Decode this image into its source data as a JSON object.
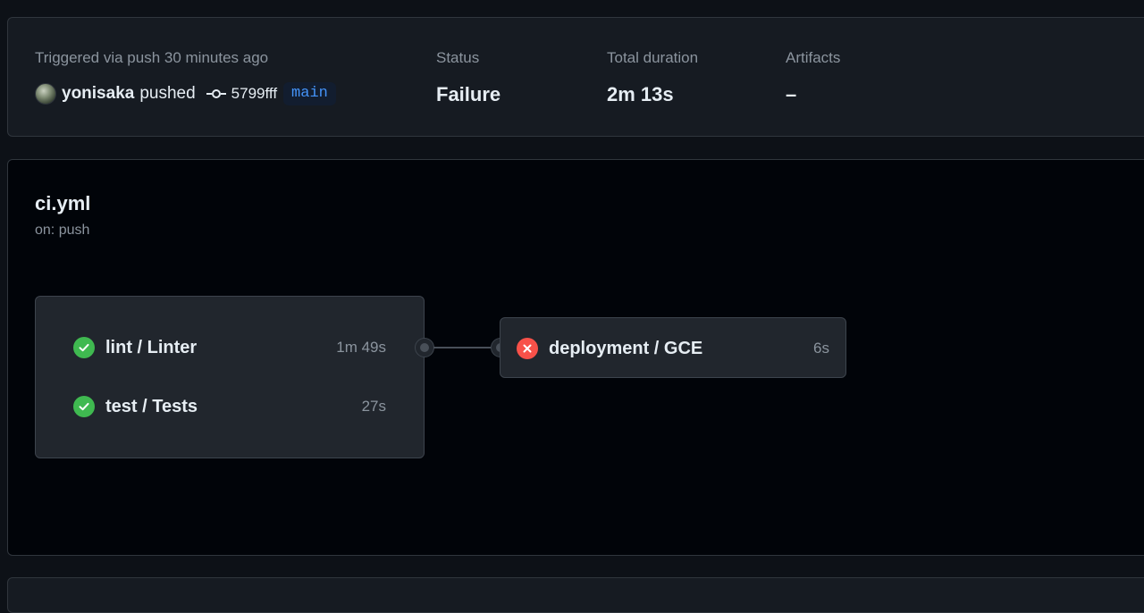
{
  "summary": {
    "trigger_label": "Triggered via push 30 minutes ago",
    "actor": "yonisaka",
    "action": "pushed",
    "commit_sha": "5799fff",
    "branch": "main",
    "status_label": "Status",
    "status_value": "Failure",
    "duration_label": "Total duration",
    "duration_value": "2m 13s",
    "artifacts_label": "Artifacts",
    "artifacts_value": "–"
  },
  "workflow": {
    "name": "ci.yml",
    "trigger": "on: push",
    "jobs": [
      {
        "name": "lint / Linter",
        "duration": "1m 49s",
        "status": "success",
        "icon": "check-circle-icon"
      },
      {
        "name": "test / Tests",
        "duration": "27s",
        "status": "success",
        "icon": "check-circle-icon"
      },
      {
        "name": "deployment / GCE",
        "duration": "6s",
        "status": "failure",
        "icon": "x-circle-icon"
      }
    ]
  },
  "colors": {
    "success": "#3fb950",
    "failure": "#f85149",
    "branch_text": "#4493f8",
    "background": "#0d1117"
  }
}
